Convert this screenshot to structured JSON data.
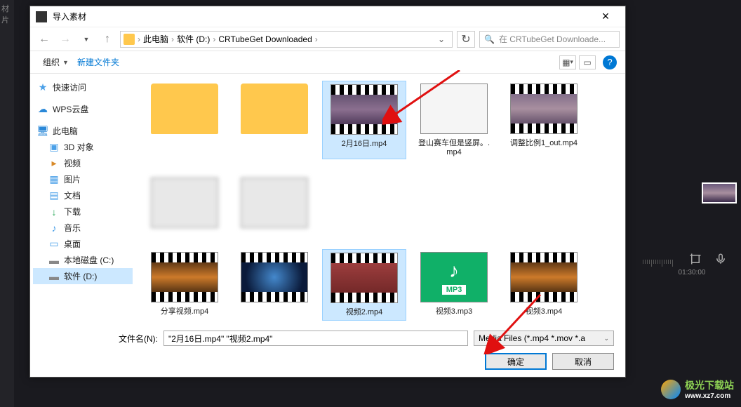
{
  "bg_sidetext": "材\n片",
  "timeline_time": "01:30:00",
  "dialog": {
    "title": "导入素材",
    "breadcrumb": {
      "pc": "此电脑",
      "drive": "软件 (D:)",
      "folder": "CRTubeGet Downloaded"
    },
    "search_placeholder": "在 CRTubeGet Downloade...",
    "toolbar": {
      "organize": "组织",
      "new_folder": "新建文件夹"
    },
    "sidebar": {
      "quick": "快速访问",
      "wps": "WPS云盘",
      "pc": "此电脑",
      "obj3d": "3D 对象",
      "videos": "视频",
      "pictures": "图片",
      "documents": "文档",
      "downloads": "下载",
      "music": "音乐",
      "desktop": "桌面",
      "localc": "本地磁盘 (C:)",
      "drived": "软件 (D:)"
    },
    "files": [
      {
        "name": "",
        "type": "folder"
      },
      {
        "name": "",
        "type": "folder"
      },
      {
        "name": "2月16日.mp4",
        "type": "video",
        "selected": true,
        "scene": "scene1"
      },
      {
        "name": "登山赛车但是竖屏。.mp4",
        "type": "app"
      },
      {
        "name": "调整比例1_out.mp4",
        "type": "video",
        "scene": "scene2"
      },
      {
        "name": "",
        "type": "blurred"
      },
      {
        "name": "",
        "type": "blurred"
      },
      {
        "name": "分享视频.mp4",
        "type": "video",
        "scene": "scene3"
      },
      {
        "name": "",
        "type": "video",
        "scene": "scene4"
      },
      {
        "name": "视频2.mp4",
        "type": "video",
        "selected": true,
        "scene": "scene5"
      },
      {
        "name": "视频3.mp3",
        "type": "mp3"
      },
      {
        "name": "视频3.mp4",
        "type": "video",
        "scene": "scene3"
      }
    ],
    "filename_label": "文件名(N):",
    "filename_value": "\"2月16日.mp4\" \"视频2.mp4\"",
    "filetype_value": "Media Files (*.mp4 *.mov *.a",
    "ok_label": "确定",
    "cancel_label": "取消"
  },
  "watermark": {
    "brand": "极光下载站",
    "url": "www.xz7.com"
  }
}
